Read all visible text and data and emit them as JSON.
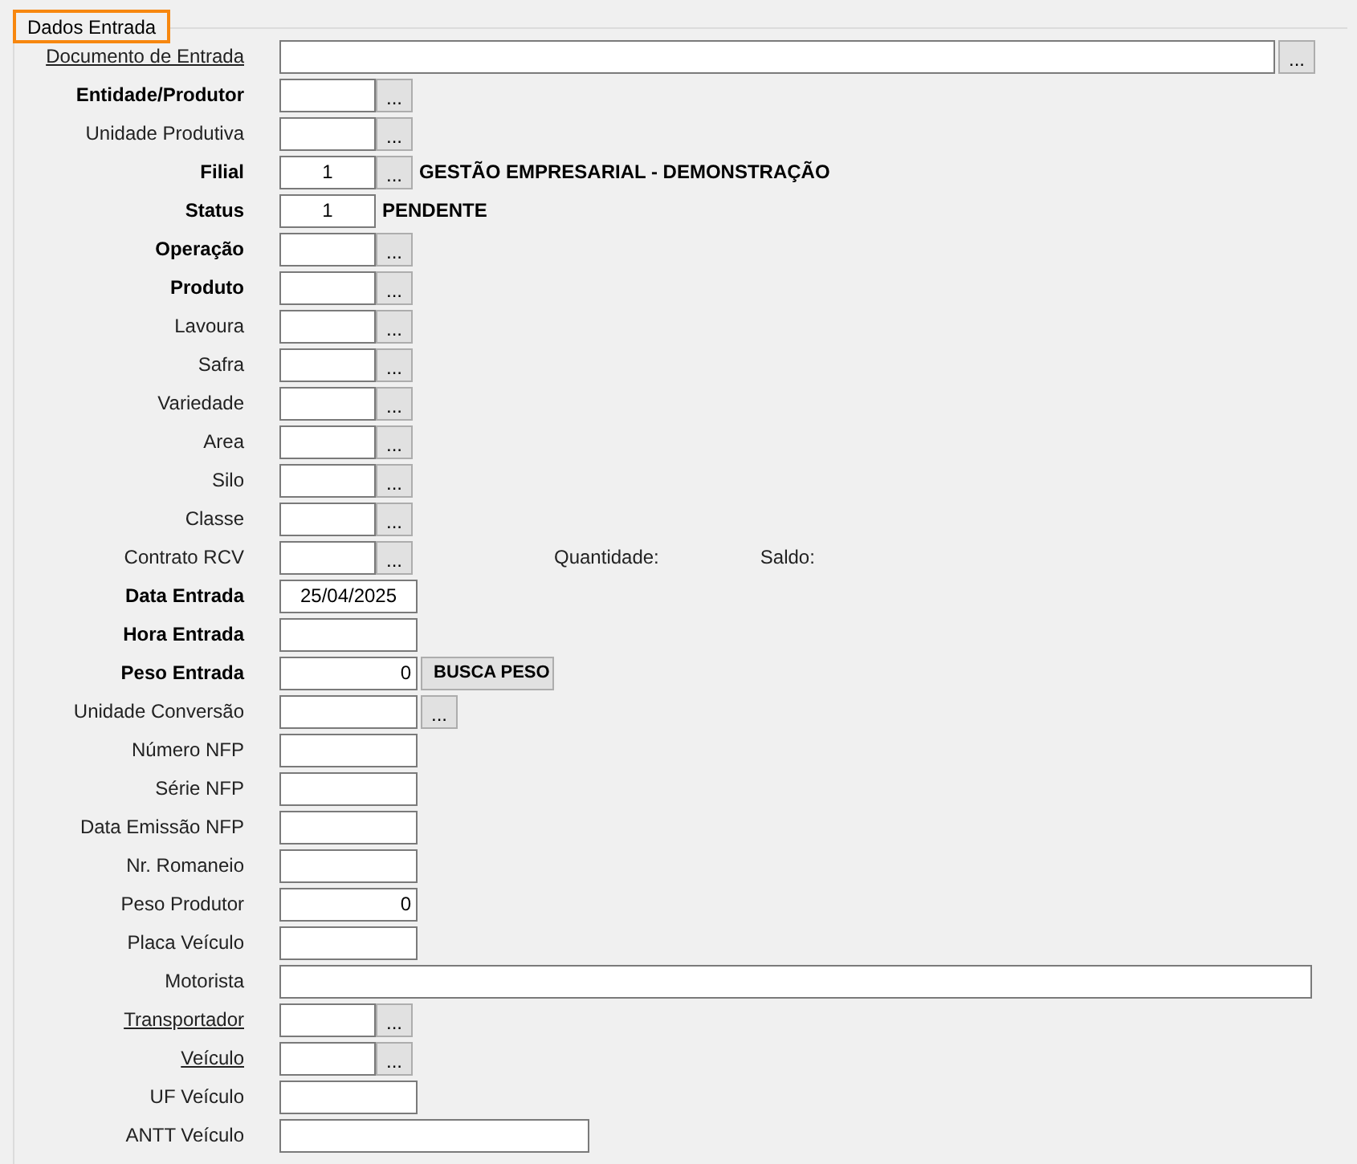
{
  "group": {
    "title": "Dados Entrada",
    "focused": true
  },
  "rows": [
    {
      "label": "Documento de Entrada",
      "required": false,
      "link": true,
      "kind": "wide",
      "lookup": "..."
    },
    {
      "label": "Entidade/Produtor",
      "required": true,
      "link": false,
      "kind": "short",
      "lookup": "..."
    },
    {
      "label": "Unidade Produtiva",
      "required": false,
      "link": false,
      "kind": "short",
      "lookup": "..."
    },
    {
      "label": "Filial",
      "required": true,
      "link": false,
      "kind": "code",
      "value": "1",
      "lookup": "...",
      "notes": [
        "GESTÃO EMPRESARIAL - DEMONSTRAÇÃO"
      ]
    },
    {
      "label": "Status",
      "required": true,
      "link": false,
      "kind": "code",
      "value": "1",
      "notes": [
        "PENDENTE"
      ]
    },
    {
      "label": "Operação",
      "required": true,
      "link": false,
      "kind": "short",
      "lookup": "..."
    },
    {
      "label": "Produto",
      "required": true,
      "link": false,
      "kind": "short",
      "lookup": "..."
    },
    {
      "label": "Lavoura",
      "required": false,
      "link": false,
      "kind": "short",
      "lookup": "..."
    },
    {
      "label": "Safra",
      "required": false,
      "link": false,
      "kind": "short",
      "lookup": "..."
    },
    {
      "label": "Variedade",
      "required": false,
      "link": false,
      "kind": "short",
      "lookup": "..."
    },
    {
      "label": "Area",
      "required": false,
      "link": false,
      "kind": "short",
      "lookup": "..."
    },
    {
      "label": "Silo",
      "required": false,
      "link": false,
      "kind": "short",
      "lookup": "..."
    },
    {
      "label": "Classe",
      "required": false,
      "link": false,
      "kind": "short",
      "lookup": "..."
    },
    {
      "label": "Contrato RCV",
      "required": false,
      "link": false,
      "kind": "short",
      "lookup": "...",
      "info": [
        "Quantidade:",
        "Saldo:"
      ]
    },
    {
      "label": "Data Entrada",
      "required": true,
      "link": false,
      "kind": "date",
      "value": "25/04/2025"
    },
    {
      "label": "Hora Entrada",
      "required": true,
      "link": false,
      "kind": "text"
    },
    {
      "label": "Peso Entrada",
      "required": true,
      "link": false,
      "kind": "number",
      "value": "0",
      "action": "BUSCA PESO"
    },
    {
      "label": "Unidade Conversão",
      "required": false,
      "link": false,
      "kind": "text",
      "lookup": "..."
    },
    {
      "label": "Número NFP",
      "required": false,
      "link": false,
      "kind": "text"
    },
    {
      "label": "Série NFP",
      "required": false,
      "link": false,
      "kind": "text"
    },
    {
      "label": "Data Emissão NFP",
      "required": false,
      "link": false,
      "kind": "text"
    },
    {
      "label": "Nr. Romaneio",
      "required": false,
      "link": false,
      "kind": "text"
    },
    {
      "label": "Peso Produtor",
      "required": false,
      "link": false,
      "kind": "number",
      "value": "0"
    },
    {
      "label": "Placa Veículo",
      "required": false,
      "link": false,
      "kind": "text"
    },
    {
      "label": "Motorista",
      "required": false,
      "link": false,
      "kind": "full"
    },
    {
      "label": "Transportador",
      "required": false,
      "link": true,
      "kind": "short",
      "lookup": "..."
    },
    {
      "label": "Veículo",
      "required": false,
      "link": true,
      "kind": "short",
      "lookup": "..."
    },
    {
      "label": "UF Veículo",
      "required": false,
      "link": false,
      "kind": "text"
    },
    {
      "label": "ANTT Veículo",
      "required": false,
      "link": false,
      "kind": "long"
    }
  ]
}
